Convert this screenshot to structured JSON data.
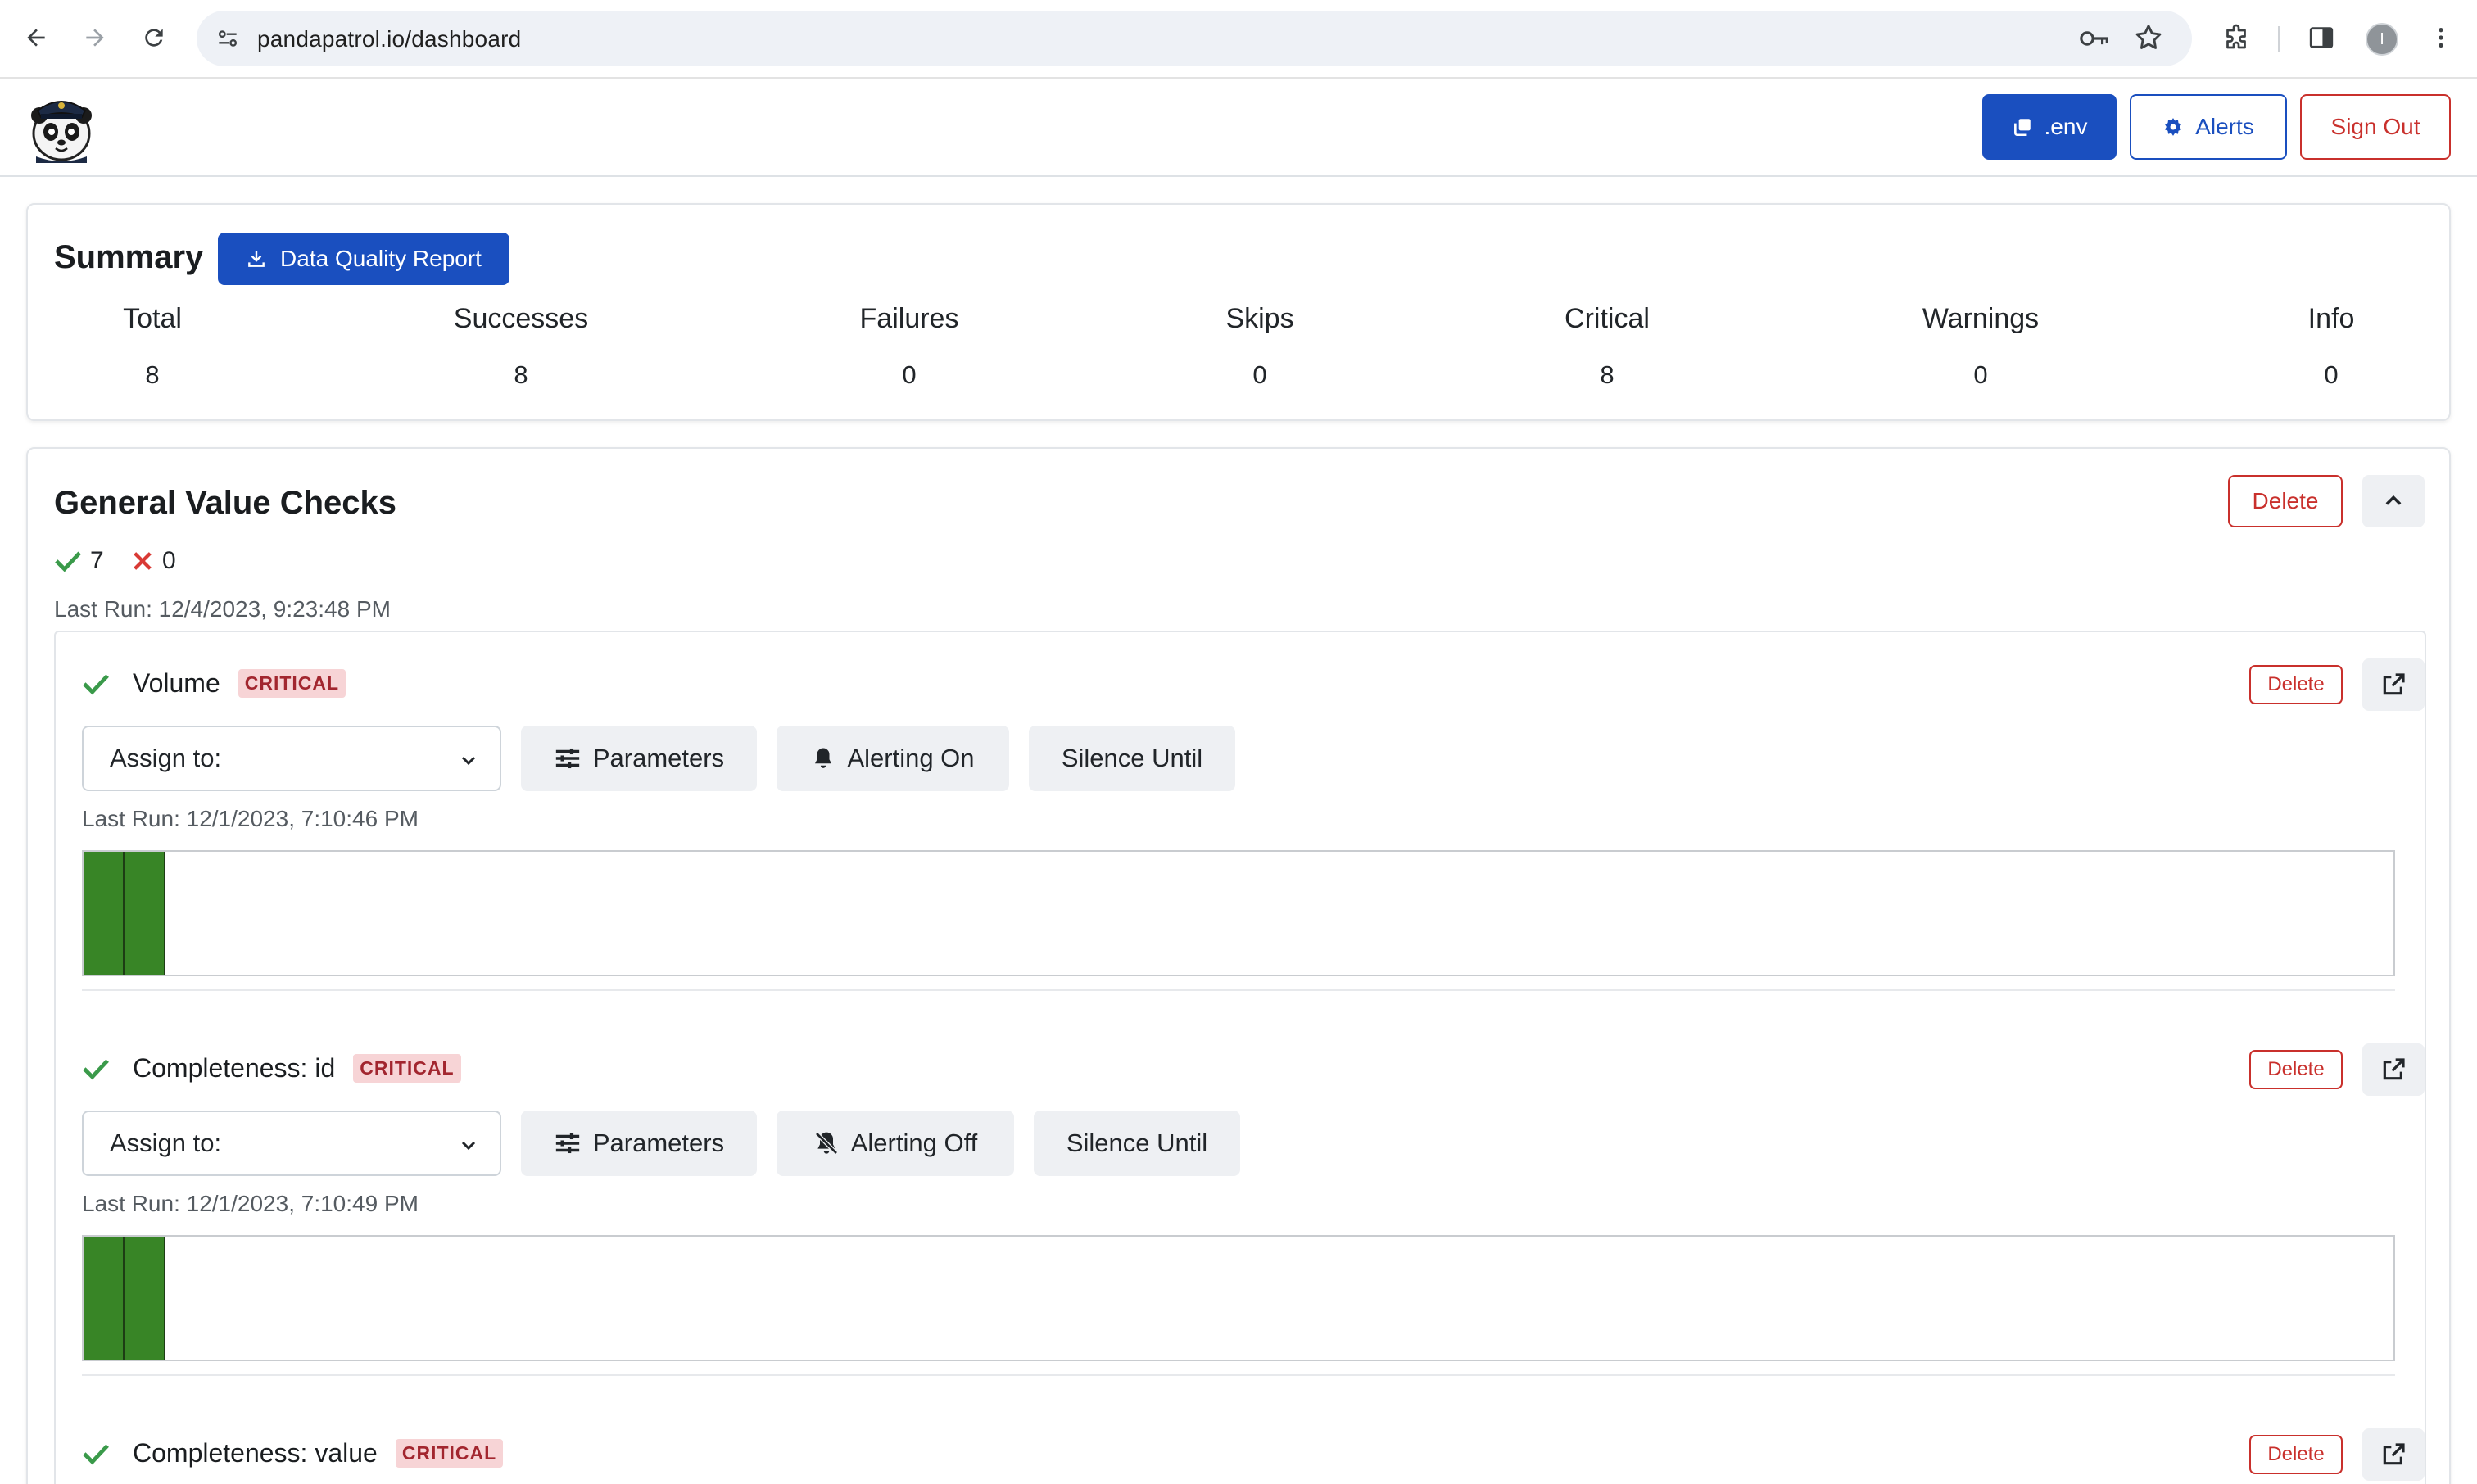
{
  "browser": {
    "url": "pandapatrol.io/dashboard",
    "avatar_initial": "I"
  },
  "header": {
    "env_label": ".env",
    "alerts_label": "Alerts",
    "signout_label": "Sign Out"
  },
  "summary": {
    "title": "Summary",
    "report_button": "Data Quality Report",
    "stats": [
      {
        "label": "Total",
        "value": "8"
      },
      {
        "label": "Successes",
        "value": "8"
      },
      {
        "label": "Failures",
        "value": "0"
      },
      {
        "label": "Skips",
        "value": "0"
      },
      {
        "label": "Critical",
        "value": "8"
      },
      {
        "label": "Warnings",
        "value": "0"
      },
      {
        "label": "Info",
        "value": "0"
      }
    ]
  },
  "group": {
    "title": "General Value Checks",
    "delete_label": "Delete",
    "pass_count": "7",
    "fail_count": "0",
    "last_run": "Last Run: 12/4/2023, 9:23:48 PM"
  },
  "checks": [
    {
      "name": "Volume",
      "severity": "CRITICAL",
      "delete_label": "Delete",
      "assign_label": "Assign to:",
      "parameters_label": "Parameters",
      "alerting_label": "Alerting On",
      "silence_label": "Silence Until",
      "last_run": "Last Run: 12/1/2023, 7:10:46 PM",
      "history_passes": 2
    },
    {
      "name": "Completeness: id",
      "severity": "CRITICAL",
      "delete_label": "Delete",
      "assign_label": "Assign to:",
      "parameters_label": "Parameters",
      "alerting_label": "Alerting Off",
      "silence_label": "Silence Until",
      "last_run": "Last Run: 12/1/2023, 7:10:49 PM",
      "history_passes": 2
    },
    {
      "name": "Completeness: value",
      "severity": "CRITICAL",
      "delete_label": "Delete"
    }
  ],
  "colors": {
    "primary": "#1a4fbf",
    "danger": "#c9302c",
    "success": "#3a9a4a",
    "history_pass": "#388526",
    "badge_bg": "#f7d4d6"
  }
}
